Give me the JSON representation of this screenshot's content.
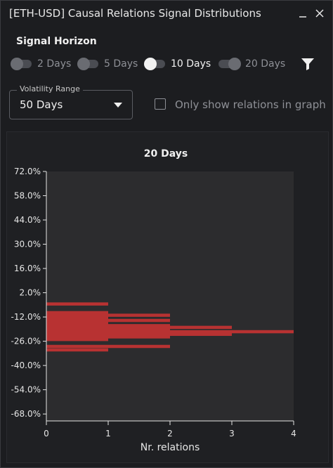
{
  "window": {
    "title": "[ETH-USD] Causal Relations Signal Distributions",
    "minimize_icon": "minimize-icon",
    "close_icon": "close-icon"
  },
  "signal_horizon": {
    "label": "Signal Horizon",
    "options": [
      {
        "label": "2 Days",
        "state": "off"
      },
      {
        "label": "5 Days",
        "state": "off"
      },
      {
        "label": "10 Days",
        "state": "on"
      },
      {
        "label": "20 Days",
        "state": "off"
      }
    ]
  },
  "filter_icon": "filter-icon",
  "volatility": {
    "legend": "Volatility Range",
    "value": "50 Days"
  },
  "only_show": {
    "label": "Only show relations in graph",
    "checked": false
  },
  "colors": {
    "bar": "#b83232",
    "plot_bg": "#2c2c2e",
    "panel_bg": "#1f2023"
  },
  "chart_data": {
    "type": "bar",
    "orientation": "horizontal",
    "title": "20 Days",
    "xlabel": "Nr. relations",
    "ylabel": "",
    "xlim": [
      0,
      4
    ],
    "ylim": [
      -72,
      72
    ],
    "x_ticks": [
      "0",
      "1",
      "2",
      "3",
      "4"
    ],
    "y_ticks": [
      "72.0%",
      "58.0%",
      "44.0%",
      "30.0%",
      "16.0%",
      "2.0%",
      "-12.0%",
      "-26.0%",
      "-40.0%",
      "-54.0%",
      "-68.0%"
    ],
    "y_tick_values": [
      72,
      58,
      44,
      30,
      16,
      2,
      -12,
      -26,
      -40,
      -54,
      -68
    ],
    "bars": [
      {
        "y": -4.5,
        "value": 1
      },
      {
        "y": -9.5,
        "value": 1
      },
      {
        "y": -11.0,
        "value": 2
      },
      {
        "y": -12.5,
        "value": 1
      },
      {
        "y": -14.0,
        "value": 2
      },
      {
        "y": -15.5,
        "value": 1
      },
      {
        "y": -17.0,
        "value": 2
      },
      {
        "y": -18.0,
        "value": 3
      },
      {
        "y": -19.5,
        "value": 2
      },
      {
        "y": -20.5,
        "value": 4
      },
      {
        "y": -22.0,
        "value": 3
      },
      {
        "y": -23.5,
        "value": 2
      },
      {
        "y": -25.0,
        "value": 1
      },
      {
        "y": -29.0,
        "value": 2
      },
      {
        "y": -31.0,
        "value": 1
      }
    ]
  }
}
